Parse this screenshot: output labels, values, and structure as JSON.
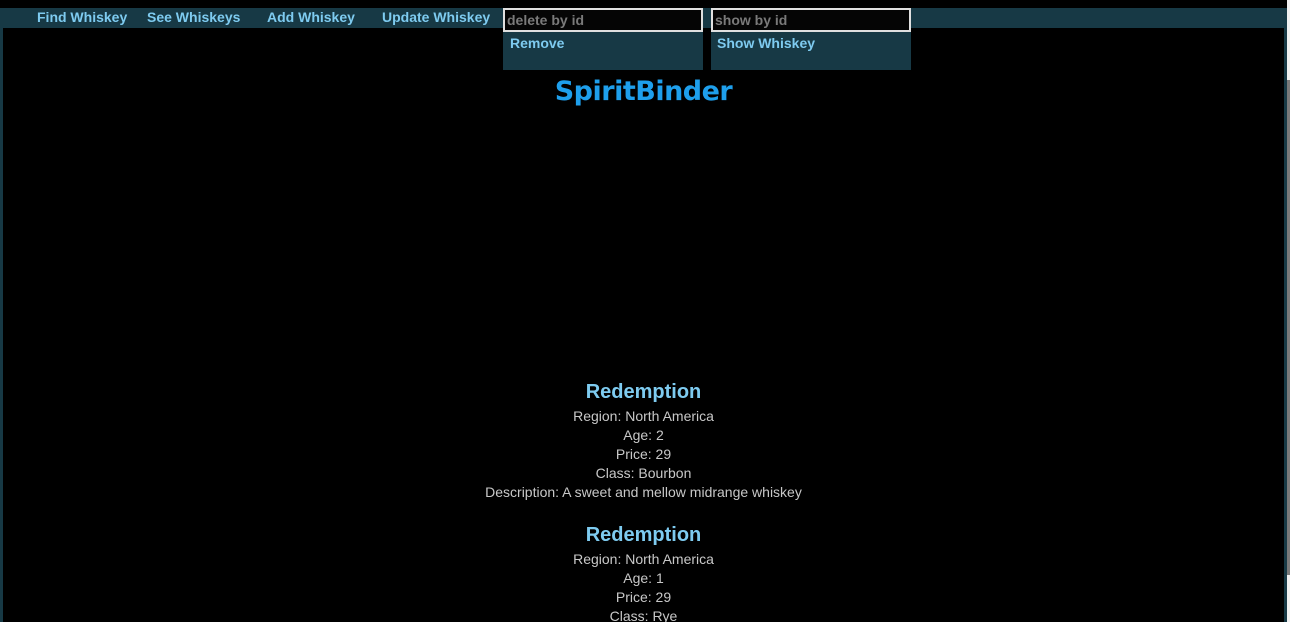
{
  "nav": {
    "find_whiskey": "Find Whiskey",
    "see_whiskeys": "See Whiskeys",
    "add_whiskey": "Add Whiskey",
    "update_whiskey": "Update Whiskey"
  },
  "delete_form": {
    "placeholder": "delete by id",
    "button_label": "Remove"
  },
  "show_form": {
    "placeholder": "show by id",
    "button_label": "Show Whiskey"
  },
  "brand": "SpiritBinder",
  "whiskeys": [
    {
      "name": "Redemption",
      "region": "Region: North America",
      "age": "Age: 2",
      "price": "Price: 29",
      "class": "Class: Bourbon",
      "description": "Description: A sweet and mellow midrange whiskey"
    },
    {
      "name": "Redemption",
      "region": "Region: North America",
      "age": "Age: 1",
      "price": "Price: 29",
      "class": "Class: Rye"
    }
  ],
  "colors": {
    "background": "#000000",
    "navbar": "#173945",
    "link": "#7ecbf0",
    "brand": "#1e9fec",
    "text": "#c8c8c8"
  }
}
